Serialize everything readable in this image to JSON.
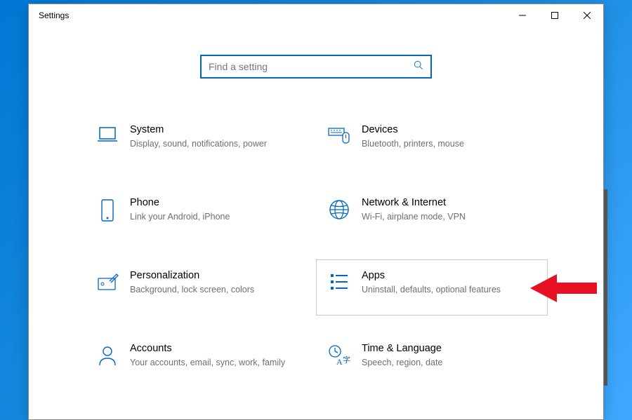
{
  "window": {
    "title": "Settings"
  },
  "search": {
    "placeholder": "Find a setting"
  },
  "tiles": {
    "system": {
      "title": "System",
      "sub": "Display, sound, notifications, power"
    },
    "devices": {
      "title": "Devices",
      "sub": "Bluetooth, printers, mouse"
    },
    "phone": {
      "title": "Phone",
      "sub": "Link your Android, iPhone"
    },
    "network": {
      "title": "Network & Internet",
      "sub": "Wi-Fi, airplane mode, VPN"
    },
    "personalize": {
      "title": "Personalization",
      "sub": "Background, lock screen, colors"
    },
    "apps": {
      "title": "Apps",
      "sub": "Uninstall, defaults, optional features"
    },
    "accounts": {
      "title": "Accounts",
      "sub": "Your accounts, email, sync, work, family"
    },
    "time": {
      "title": "Time & Language",
      "sub": "Speech, region, date"
    }
  }
}
